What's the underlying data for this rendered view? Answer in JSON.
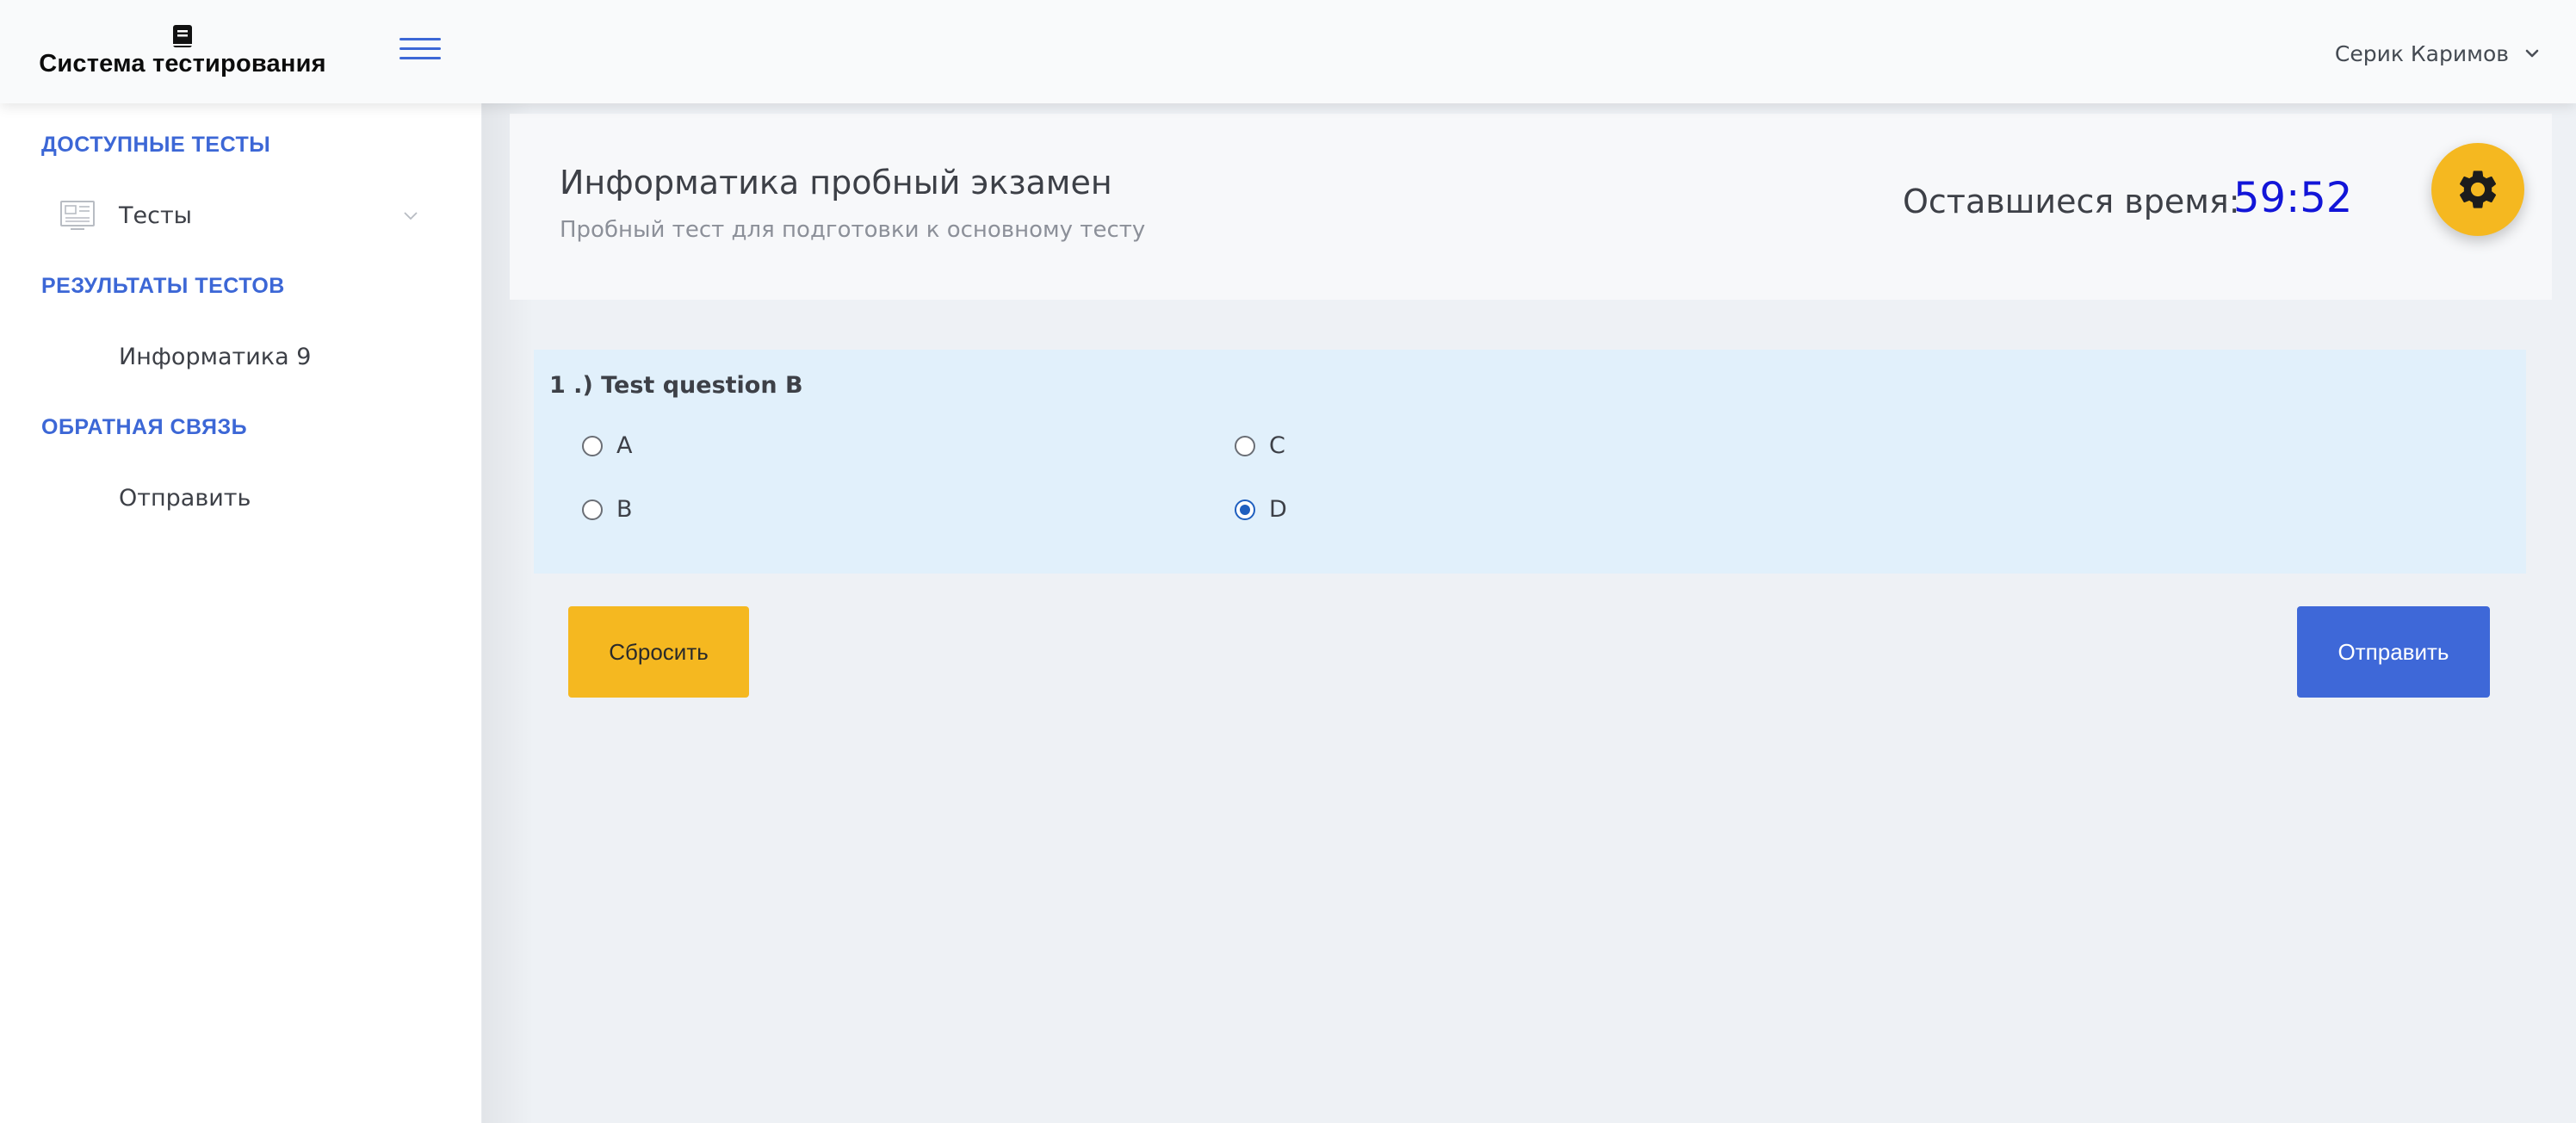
{
  "header": {
    "brand_title": "Система тестирования",
    "brand_icon": "book-icon",
    "menu_icon": "hamburger-icon",
    "user_name": "Серик Каримов",
    "accent_color": "#3c67d6"
  },
  "sidebar": {
    "sections": [
      {
        "heading": "ДОСТУПНЫЕ ТЕСТЫ",
        "items": [
          {
            "label": "Тесты",
            "icon": "newspaper-icon",
            "expandable": true
          }
        ]
      },
      {
        "heading": "РЕЗУЛЬТАТЫ ТЕСТОВ",
        "items": [
          {
            "label": "Информатика 9"
          }
        ]
      },
      {
        "heading": "ОБРАТНАЯ СВЯЗЬ",
        "items": [
          {
            "label": "Отправить"
          }
        ]
      }
    ]
  },
  "exam": {
    "title": "Информатика пробный экзамен",
    "subtitle": "Пробный тест для подготовки к основному тесту",
    "timer_label": "Оставшиеся время:",
    "timer_value": "59:52",
    "timer_color": "#1215d8"
  },
  "question": {
    "text": "1 .) Test question B",
    "options": [
      {
        "label": "A",
        "checked": false
      },
      {
        "label": "B",
        "checked": false
      },
      {
        "label": "C",
        "checked": false
      },
      {
        "label": "D",
        "checked": true
      }
    ]
  },
  "actions": {
    "reset_label": "Сбросить",
    "submit_label": "Отправить",
    "reset_color": "#f5b820",
    "submit_color": "#3e68d8"
  },
  "fab": {
    "icon": "gear-icon"
  }
}
